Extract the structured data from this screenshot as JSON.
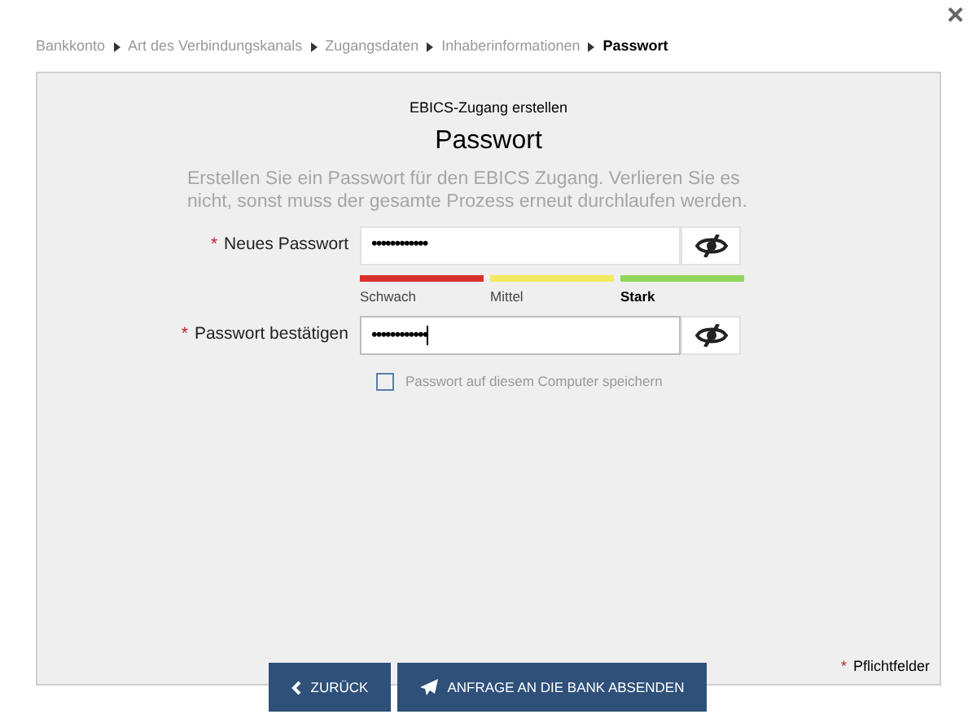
{
  "close": "×",
  "breadcrumb": [
    {
      "label": "Bankkonto",
      "selected": false
    },
    {
      "label": "Art des Verbindungskanals",
      "selected": false
    },
    {
      "label": "Zugangsdaten",
      "selected": false
    },
    {
      "label": "Inhaberinformationen",
      "selected": false
    },
    {
      "label": "Passwort",
      "selected": true
    }
  ],
  "panel": {
    "subtitle": "EBICS-Zugang erstellen",
    "title": "Passwort",
    "description": "Erstellen Sie ein Passwort für den EBICS Zugang. Verlieren Sie es nicht, sonst muss der gesamte Prozess erneut durchlaufen werden."
  },
  "fields": [
    {
      "required_mark": "*",
      "label": "Neues Passwort",
      "value": "••••••••••••",
      "focused": false
    },
    {
      "required_mark": "*",
      "label": "Passwort bestätigen",
      "value": "••••••••••••",
      "focused": true
    }
  ],
  "strength": [
    {
      "label": "Schwach",
      "color": "#d9302c",
      "selected": false
    },
    {
      "label": "Mittel",
      "color": "#f2ea5e",
      "selected": false
    },
    {
      "label": "Stark",
      "color": "#8fd65a",
      "selected": true
    }
  ],
  "remember": {
    "label": "Passwort auf diesem Computer speichern",
    "checked": false
  },
  "required_note": {
    "mark": "*",
    "label": "Pflichtfelder"
  },
  "buttons": [
    {
      "kind": "back",
      "label": "ZURÜCK"
    },
    {
      "kind": "send",
      "label": "ANFRAGE AN DIE BANK ABSENDEN"
    }
  ]
}
